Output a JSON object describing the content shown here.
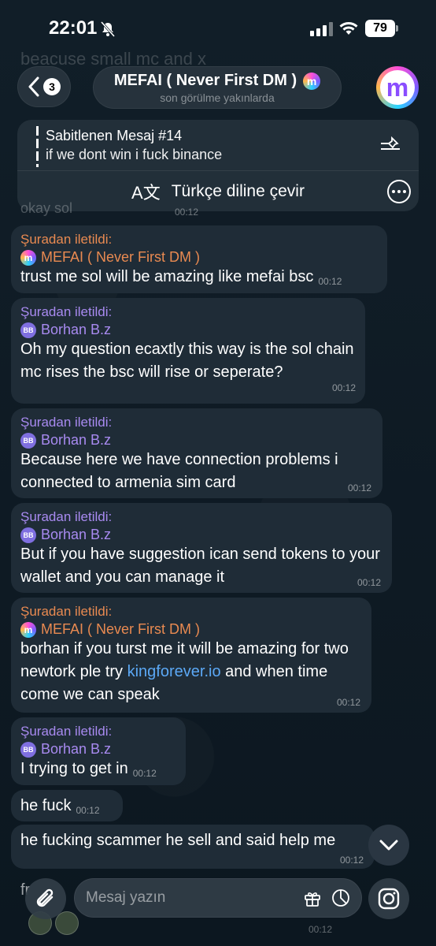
{
  "status_bar": {
    "time": "22:01",
    "battery": "79"
  },
  "ghost": {
    "line1": "beacuse small mc and x"
  },
  "header": {
    "back_count": "3",
    "title": "MEFAI ( Never First DM )",
    "subtitle": "son görülme yakınlarda",
    "avatar_letter": "m"
  },
  "pinned": {
    "title": "Sabitlenen Mesaj #14",
    "text": "if we dont win i fuck binance",
    "translate_label": "Türkçe diline çevir"
  },
  "partial_prev": {
    "text": "okay sol",
    "time": "00:12"
  },
  "messages": [
    {
      "fwd_label": "Şuradan iletildi:",
      "from": "MEFAI ( Never First DM )",
      "text": "trust me sol will be amazing like mefai bsc",
      "time": "00:12"
    },
    {
      "fwd_label": "Şuradan iletildi:",
      "from": "Borhan B.z",
      "text": "Oh my question ecaxtly this way is the sol chain mc rises the bsc will rise or seperate?",
      "time": "00:12"
    },
    {
      "fwd_label": "Şuradan iletildi:",
      "from": "Borhan B.z",
      "text": "Because here we have connection problems i connected to armenia sim card",
      "time": "00:12"
    },
    {
      "fwd_label": "Şuradan iletildi:",
      "from": "Borhan B.z",
      "text": "But if you have suggestion ican send tokens to your wallet and you can manage it",
      "time": "00:12"
    },
    {
      "fwd_label": "Şuradan iletildi:",
      "from": "MEFAI ( Never First DM )",
      "text_before": "borhan if you turst me it will be amazing for two newtork ple try ",
      "link": "kingforever.io",
      "text_after": " and when time come we can speak",
      "time": "00:12"
    },
    {
      "fwd_label": "Şuradan iletildi:",
      "from": "Borhan B.z",
      "text": "I trying to get in",
      "time": "00:12"
    },
    {
      "text": "he fuck",
      "time": "00:12"
    },
    {
      "text": "he fucking scammer he sell and said help me",
      "time": "00:12"
    }
  ],
  "badges": {
    "bb": "BB",
    "m": "m"
  },
  "input": {
    "placeholder": "Mesaj yazın"
  },
  "ghost_bottom": {
    "text": "fr",
    "time": "00:12"
  }
}
